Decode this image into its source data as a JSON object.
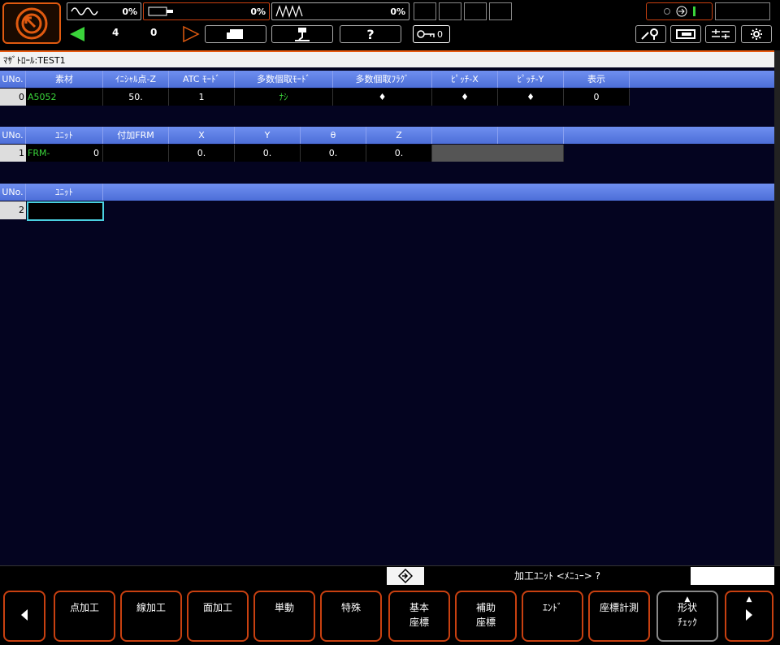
{
  "status": {
    "meter1_value": "0%",
    "meter2_value": "0%",
    "meter3_value": "0%",
    "counter_a": "4",
    "counter_b": "0",
    "help_label": "?",
    "key_count": "0"
  },
  "window_title": "ﾏｻﾞﾄﾛｰﾙ:TEST1",
  "table1": {
    "headers": [
      "UNo.",
      "素材",
      "ｲﾆｼｬﾙ点-Z",
      "ATC ﾓｰﾄﾞ",
      "多数個取ﾓｰﾄﾞ",
      "多数個取ﾌﾗｸﾞ",
      "ﾋﾟｯﾁ-X",
      "ﾋﾟｯﾁ-Y",
      "表示"
    ],
    "row": {
      "uno": "0",
      "material": "A5052",
      "initial_z": "50.",
      "atc_mode": "1",
      "multi_mode": "ﾅｼ",
      "multi_flag": "♦",
      "pitch_x": "♦",
      "pitch_y": "♦",
      "display": "0"
    }
  },
  "table2": {
    "headers": [
      "UNo.",
      "ﾕﾆｯﾄ",
      "付加FRM",
      "X",
      "Y",
      "θ",
      "Z"
    ],
    "row": {
      "uno": "1",
      "unit": "FRM-",
      "unit_num": "0",
      "frm": "",
      "x": "0.",
      "y": "0.",
      "theta": "0.",
      "z": "0."
    }
  },
  "table3": {
    "headers": [
      "UNo.",
      "ﾕﾆｯﾄ"
    ],
    "row": {
      "uno": "2",
      "unit": ""
    }
  },
  "message": "加工ﾕﾆｯﾄ <ﾒﾆｭｰ> ?",
  "function_keys": {
    "k1": "点加工",
    "k2": "線加工",
    "k3": "面加工",
    "k4": "単動",
    "k5": "特殊",
    "k6a": "基本",
    "k6b": "座標",
    "k7a": "補助",
    "k7b": "座標",
    "k8": "ｴﾝﾄﾞ",
    "k9": "座標計測",
    "k10a": "形状",
    "k10b": "ﾁｪｯｸ"
  },
  "colors": {
    "accent": "#e05a10",
    "header_blue": "#5a7ce4",
    "green_text": "#3ad43a",
    "background": "#040420"
  }
}
